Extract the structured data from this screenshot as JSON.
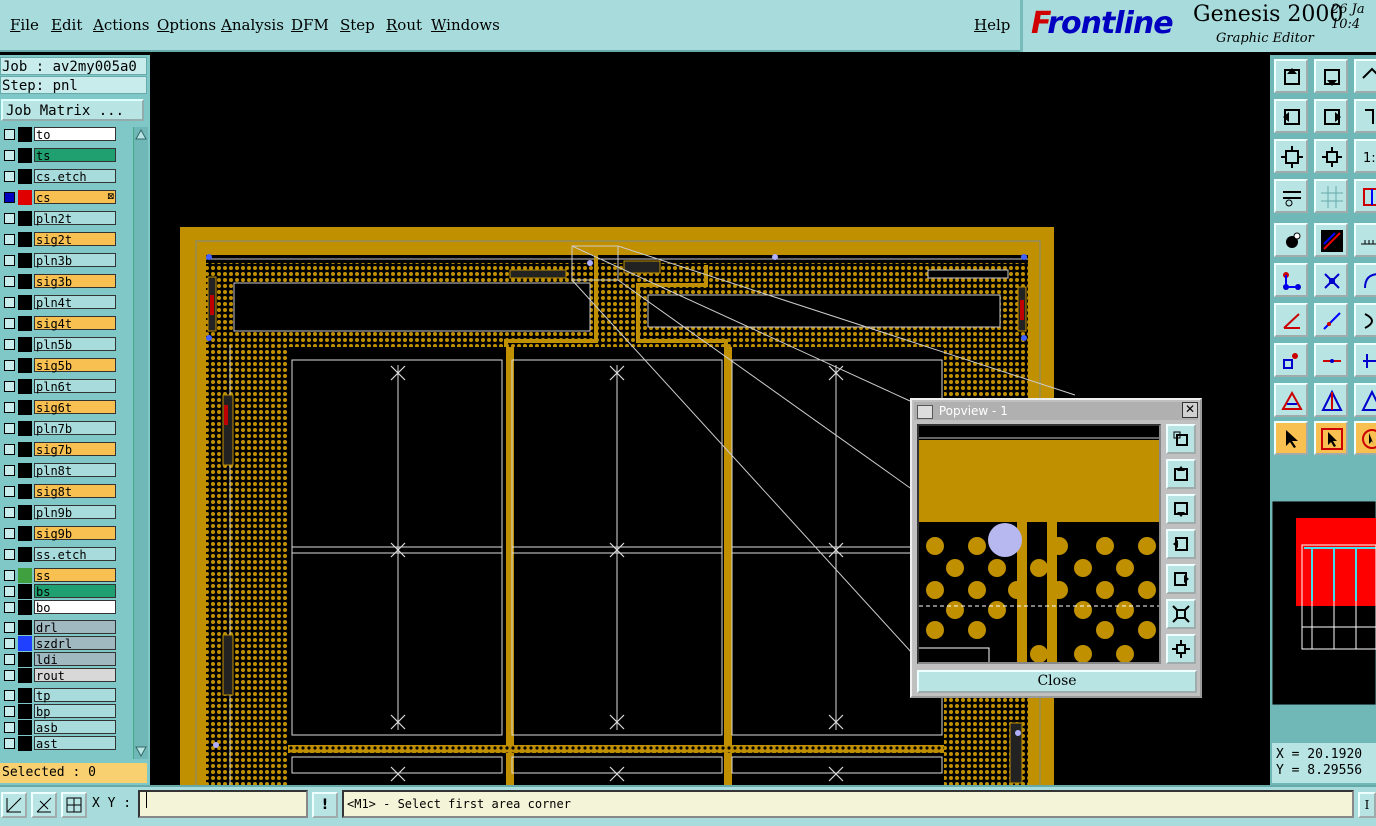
{
  "menu": {
    "items": [
      "File",
      "Edit",
      "Actions",
      "Options",
      "Analysis",
      "DFM",
      "Step",
      "Rout",
      "Windows"
    ],
    "help": "Help"
  },
  "branding": {
    "logo_f": "F",
    "logo_rest": "rontline",
    "product": "Genesis 2000",
    "subtitle": "Graphic Editor",
    "date_line1": "26 Ja",
    "date_line2": "10:4"
  },
  "job": {
    "job_line": "Job : av2my005a0",
    "step_line": "Step: pnl",
    "job_matrix_button": "Job Matrix ..."
  },
  "layers": [
    {
      "name": "to",
      "color": "#ffffff",
      "swatch": ""
    },
    {
      "name": "ts",
      "color": "#20a070",
      "swatch": ""
    },
    {
      "name": "cs.etch",
      "color": "#a8dcdc",
      "swatch": ""
    },
    {
      "name": "cs",
      "color": "#f8c050",
      "swatch": "#e00000",
      "active": true,
      "marker": "⊠"
    },
    {
      "name": "pln2t",
      "color": "#a8dcdc",
      "swatch": ""
    },
    {
      "name": "sig2t",
      "color": "#f8c050",
      "swatch": ""
    },
    {
      "name": "pln3b",
      "color": "#a8dcdc",
      "swatch": ""
    },
    {
      "name": "sig3b",
      "color": "#f8c050",
      "swatch": ""
    },
    {
      "name": "pln4t",
      "color": "#a8dcdc",
      "swatch": ""
    },
    {
      "name": "sig4t",
      "color": "#f8c050",
      "swatch": ""
    },
    {
      "name": "pln5b",
      "color": "#a8dcdc",
      "swatch": ""
    },
    {
      "name": "sig5b",
      "color": "#f8c050",
      "swatch": ""
    },
    {
      "name": "pln6t",
      "color": "#a8dcdc",
      "swatch": ""
    },
    {
      "name": "sig6t",
      "color": "#f8c050",
      "swatch": ""
    },
    {
      "name": "pln7b",
      "color": "#a8dcdc",
      "swatch": ""
    },
    {
      "name": "sig7b",
      "color": "#f8c050",
      "swatch": ""
    },
    {
      "name": "pln8t",
      "color": "#a8dcdc",
      "swatch": ""
    },
    {
      "name": "sig8t",
      "color": "#f8c050",
      "swatch": ""
    },
    {
      "name": "pln9b",
      "color": "#a8dcdc",
      "swatch": ""
    },
    {
      "name": "sig9b",
      "color": "#f8c050",
      "swatch": ""
    },
    {
      "name": "ss.etch",
      "color": "#a8dcdc",
      "swatch": ""
    },
    {
      "name": "ss",
      "color": "#f8c050",
      "swatch": "#40a040"
    },
    {
      "name": "bs",
      "color": "#20a070",
      "swatch": ""
    },
    {
      "name": "bo",
      "color": "#ffffff",
      "swatch": ""
    },
    {
      "name": "drl",
      "color": "#a0b8c0",
      "swatch": ""
    },
    {
      "name": "szdrl",
      "color": "#a0b8c0",
      "swatch": "#2040ff"
    },
    {
      "name": "ldi",
      "color": "#a0b8c0",
      "swatch": ""
    },
    {
      "name": "rout",
      "color": "#d8d8d8",
      "swatch": ""
    },
    {
      "name": "tp",
      "color": "#a8dcdc",
      "swatch": ""
    },
    {
      "name": "bp",
      "color": "#a8dcdc",
      "swatch": ""
    },
    {
      "name": "asb",
      "color": "#a8dcdc",
      "swatch": ""
    },
    {
      "name": "ast",
      "color": "#a8dcdc",
      "swatch": ""
    }
  ],
  "selected": "Selected : 0",
  "popview": {
    "title": "Popview - 1",
    "close_x": "✕",
    "close_button": "Close"
  },
  "coords": {
    "x": "X = 20.1920",
    "y": "Y = 8.29556"
  },
  "bottom": {
    "xy_label": "X Y :",
    "xy_value": "",
    "alert_icon": "!",
    "status": "<M1> - Select first area corner",
    "end_button": "I"
  },
  "colors": {
    "copper": "#c09000",
    "panel": "#a8dcdc"
  }
}
